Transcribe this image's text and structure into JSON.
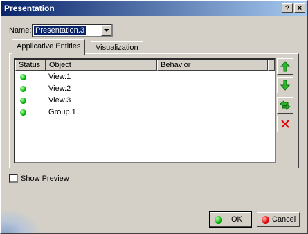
{
  "window": {
    "title": "Presentation",
    "help_label": "?",
    "close_label": "×"
  },
  "name_field": {
    "label": "Name:",
    "value": "Presentation.3"
  },
  "tabs": [
    {
      "label": "Applicative Entities",
      "active": true
    },
    {
      "label": "Visualization",
      "active": false
    }
  ],
  "list": {
    "columns": [
      "Status",
      "Object",
      "Behavior"
    ],
    "rows": [
      {
        "status": "green",
        "object": "View.1",
        "behavior": ""
      },
      {
        "status": "green",
        "object": "View.2",
        "behavior": ""
      },
      {
        "status": "green",
        "object": "View.3",
        "behavior": ""
      },
      {
        "status": "green",
        "object": "Group.1",
        "behavior": ""
      }
    ]
  },
  "side_buttons": [
    "move-up-icon",
    "move-down-icon",
    "replace-icon",
    "delete-icon"
  ],
  "show_preview": {
    "label": "Show Preview",
    "checked": false
  },
  "buttons": {
    "ok": "OK",
    "cancel": "Cancel"
  },
  "colors": {
    "title_start": "#0a246a",
    "title_end": "#a6caf0",
    "status_green": "#00b000",
    "arrow_green": "#2db52d",
    "delete_red": "#e00000"
  }
}
